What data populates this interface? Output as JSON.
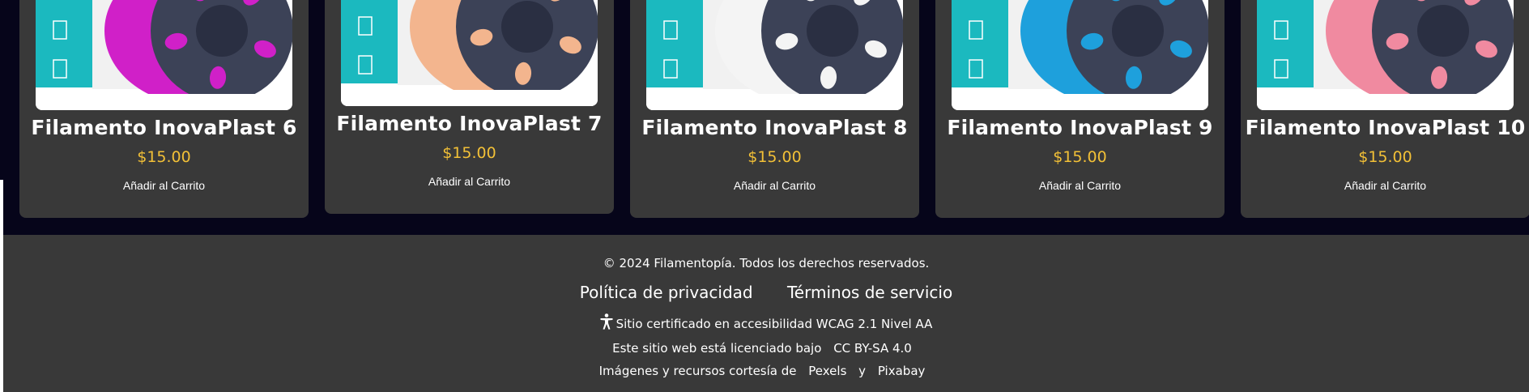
{
  "products": [
    {
      "name": "Filamento InovaPlast 6",
      "price": "$15.00",
      "cart_label": "Añadir al Carrito",
      "color": "#d020c8"
    },
    {
      "name": "Filamento InovaPlast 7",
      "price": "$15.00",
      "cart_label": "Añadir al Carrito",
      "color": "#f3b58e"
    },
    {
      "name": "Filamento InovaPlast 8",
      "price": "$15.00",
      "cart_label": "Añadir al Carrito",
      "color": "#f4f4f4"
    },
    {
      "name": "Filamento InovaPlast 9",
      "price": "$15.00",
      "cart_label": "Añadir al Carrito",
      "color": "#1ea0dc"
    },
    {
      "name": "Filamento InovaPlast 10",
      "price": "$15.00",
      "cart_label": "Añadir al Carrito",
      "color": "#f08aa0"
    }
  ],
  "footer": {
    "copyright": "© 2024 Filamentopía. Todos los derechos reservados.",
    "privacy": "Política de privacidad",
    "terms": "Términos de servicio",
    "accessibility": "Sitio certificado en accesibilidad WCAG 2.1 Nivel AA",
    "license_prefix": "Este sitio web está licenciado bajo",
    "license_link": "CC BY-SA 4.0",
    "resources_prefix": "Imágenes y recursos cortesía de",
    "pexels": "Pexels",
    "and": "y",
    "pixabay": "Pixabay"
  },
  "colors": {
    "price": "#f2c037",
    "card_bg": "#393939",
    "page_bg": "#06051a"
  }
}
